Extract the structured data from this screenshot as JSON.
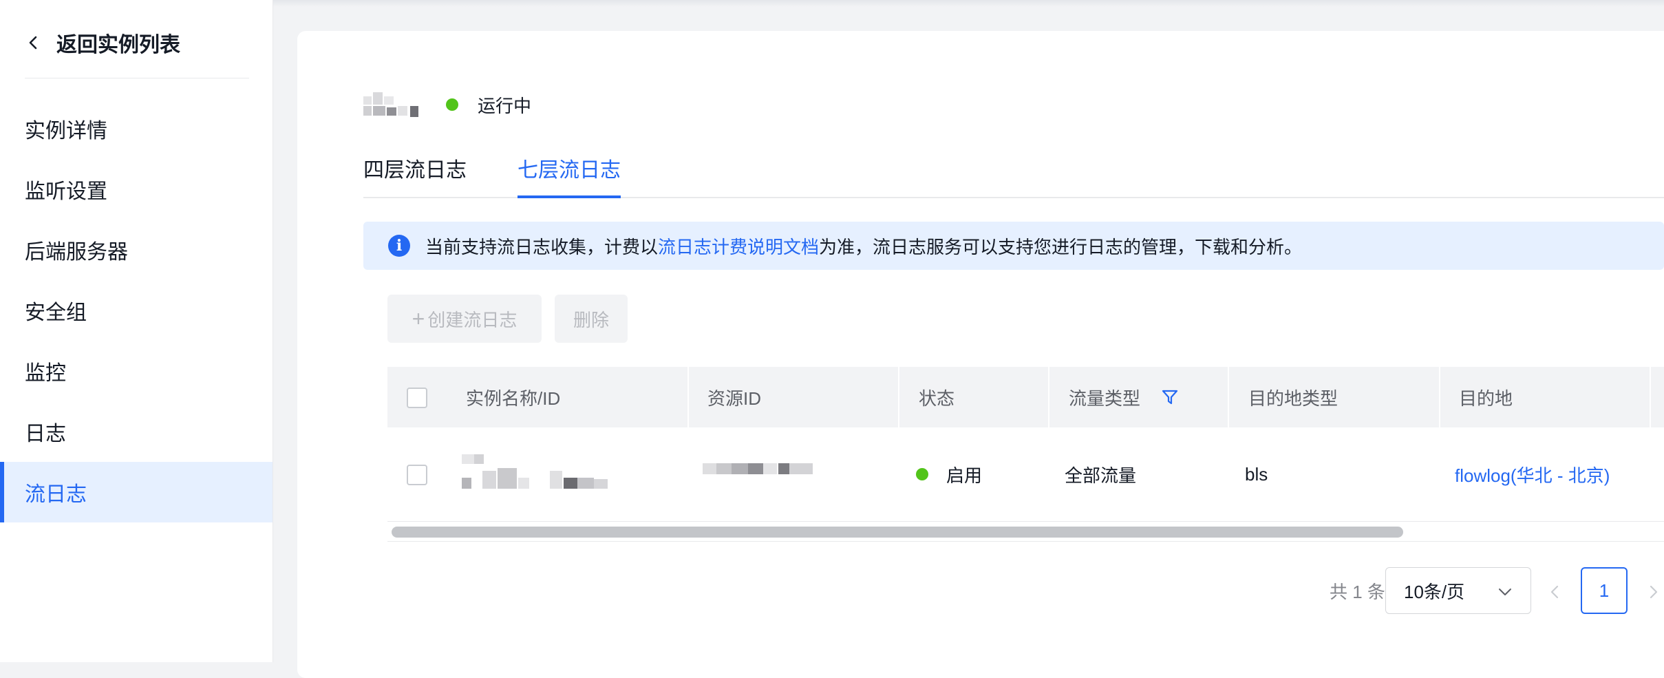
{
  "sidebar": {
    "back_label": "返回实例列表",
    "items": [
      {
        "label": "实例详情",
        "active": false
      },
      {
        "label": "监听设置",
        "active": false
      },
      {
        "label": "后端服务器",
        "active": false
      },
      {
        "label": "安全组",
        "active": false
      },
      {
        "label": "监控",
        "active": false
      },
      {
        "label": "日志",
        "active": false
      },
      {
        "label": "流日志",
        "active": true
      }
    ]
  },
  "header": {
    "status_text": "运行中",
    "status_color": "#52c41a"
  },
  "tabs": [
    {
      "label": "四层流日志",
      "active": false
    },
    {
      "label": "七层流日志",
      "active": true
    }
  ],
  "notice": {
    "prefix": "当前支持流日志收集，计费以",
    "link": "流日志计费说明文档",
    "suffix": "为准，流日志服务可以支持您进行日志的管理，下载和分析。"
  },
  "toolbar": {
    "create_label": "创建流日志",
    "delete_label": "删除"
  },
  "table": {
    "columns": [
      "实例名称/ID",
      "资源ID",
      "状态",
      "流量类型",
      "目的地类型",
      "目的地"
    ],
    "rows": [
      {
        "status": "启用",
        "traffic_type": "全部流量",
        "dest_type": "bls",
        "destination": "flowlog(华北 - 北京)"
      }
    ]
  },
  "pagination": {
    "total_label": "共 1 条",
    "page_size": "10条/页",
    "current_page": "1"
  },
  "colors": {
    "accent": "#2468f2",
    "success": "#52c41a",
    "active_bg": "#e6f0ff"
  }
}
